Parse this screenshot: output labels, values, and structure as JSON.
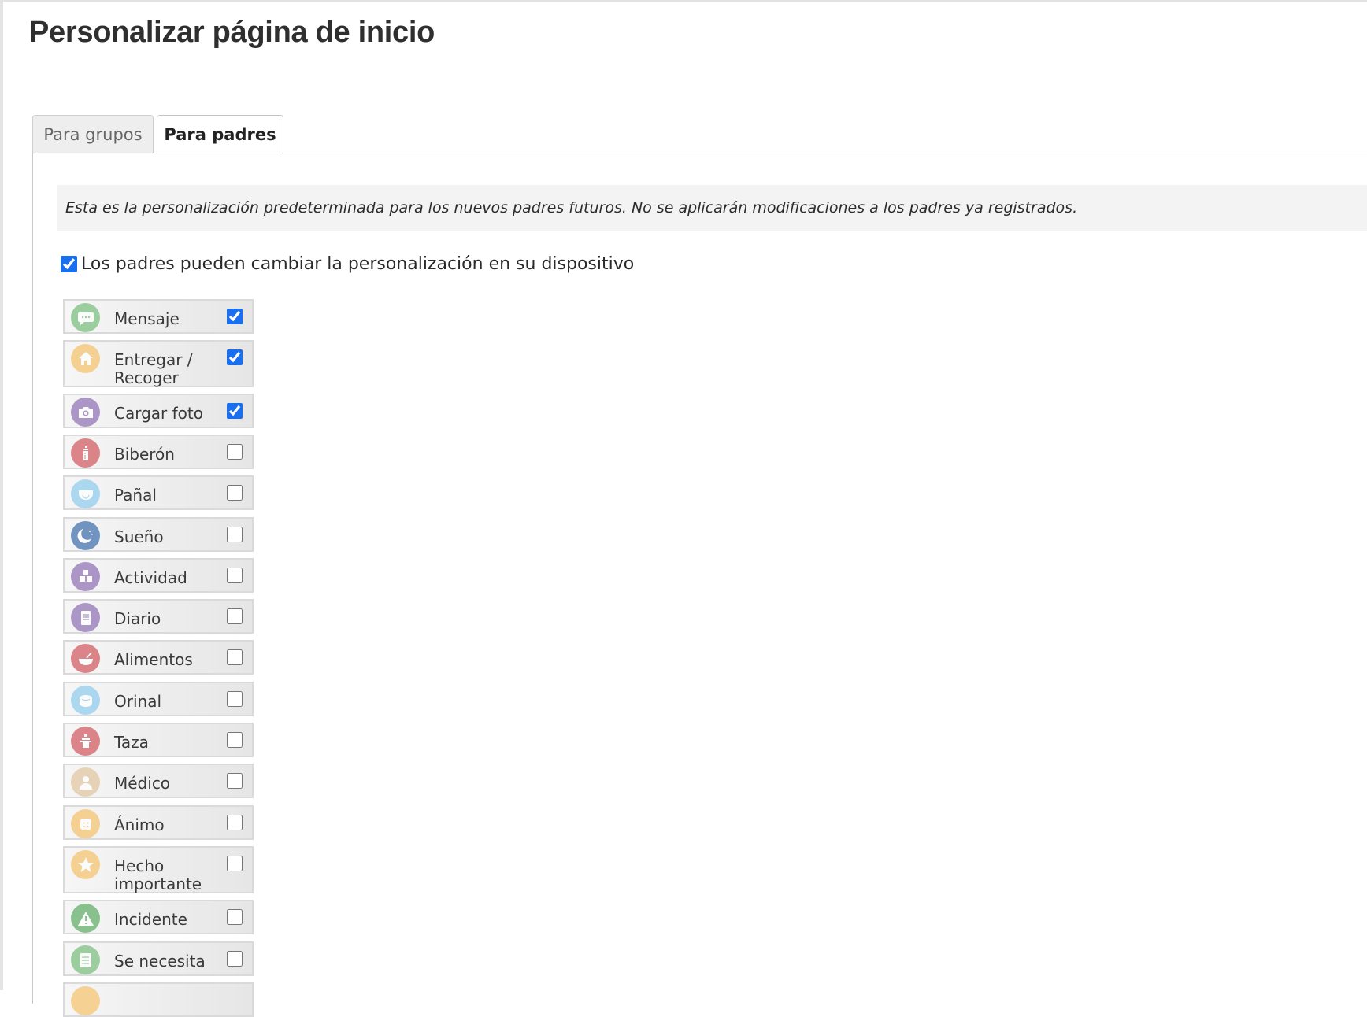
{
  "page": {
    "title": "Personalizar página de inicio"
  },
  "tabs": [
    {
      "label": "Para grupos",
      "active": false
    },
    {
      "label": "Para padres",
      "active": true
    }
  ],
  "notice": "Esta es la personalización predeterminada para los nuevos padres futuros. No se aplicarán modificaciones a los padres ya registrados.",
  "master_option": {
    "label": "Los padres pueden cambiar la personalización en su dispositivo",
    "checked": true
  },
  "items": [
    {
      "label": "Mensaje",
      "checked": true,
      "icon": "message-bubble-icon",
      "color": "#7bbf7e"
    },
    {
      "label": "Entregar / Recoger",
      "checked": true,
      "icon": "house-icon",
      "color": "#f5c36e"
    },
    {
      "label": "Cargar foto",
      "checked": true,
      "icon": "camera-icon",
      "color": "#8f72b5"
    },
    {
      "label": "Biberón",
      "checked": false,
      "icon": "baby-bottle-icon",
      "color": "#d25a60"
    },
    {
      "label": "Pañal",
      "checked": false,
      "icon": "diaper-icon",
      "color": "#8fcdee"
    },
    {
      "label": "Sueño",
      "checked": false,
      "icon": "moon-icon",
      "color": "#3f6fad"
    },
    {
      "label": "Actividad",
      "checked": false,
      "icon": "blocks-icon",
      "color": "#8f72b5"
    },
    {
      "label": "Diario",
      "checked": false,
      "icon": "notebook-icon",
      "color": "#8f72b5"
    },
    {
      "label": "Alimentos",
      "checked": false,
      "icon": "food-bowl-icon",
      "color": "#d25a60"
    },
    {
      "label": "Orinal",
      "checked": false,
      "icon": "potty-icon",
      "color": "#8fcdee"
    },
    {
      "label": "Taza",
      "checked": false,
      "icon": "sippy-cup-icon",
      "color": "#d25a60"
    },
    {
      "label": "Médico",
      "checked": false,
      "icon": "doctor-icon",
      "color": "#e2c7a0"
    },
    {
      "label": "Ánimo",
      "checked": false,
      "icon": "smiley-icon",
      "color": "#f5c36e"
    },
    {
      "label": "Hecho importante",
      "checked": false,
      "icon": "star-icon",
      "color": "#f5c36e"
    },
    {
      "label": "Incidente",
      "checked": false,
      "icon": "warning-icon",
      "color": "#5fae66"
    },
    {
      "label": "Se necesita",
      "checked": false,
      "icon": "checklist-icon",
      "color": "#7bbf7e"
    },
    {
      "label": "",
      "checked": false,
      "icon": "partial-icon",
      "color": "#f5c36e"
    }
  ]
}
